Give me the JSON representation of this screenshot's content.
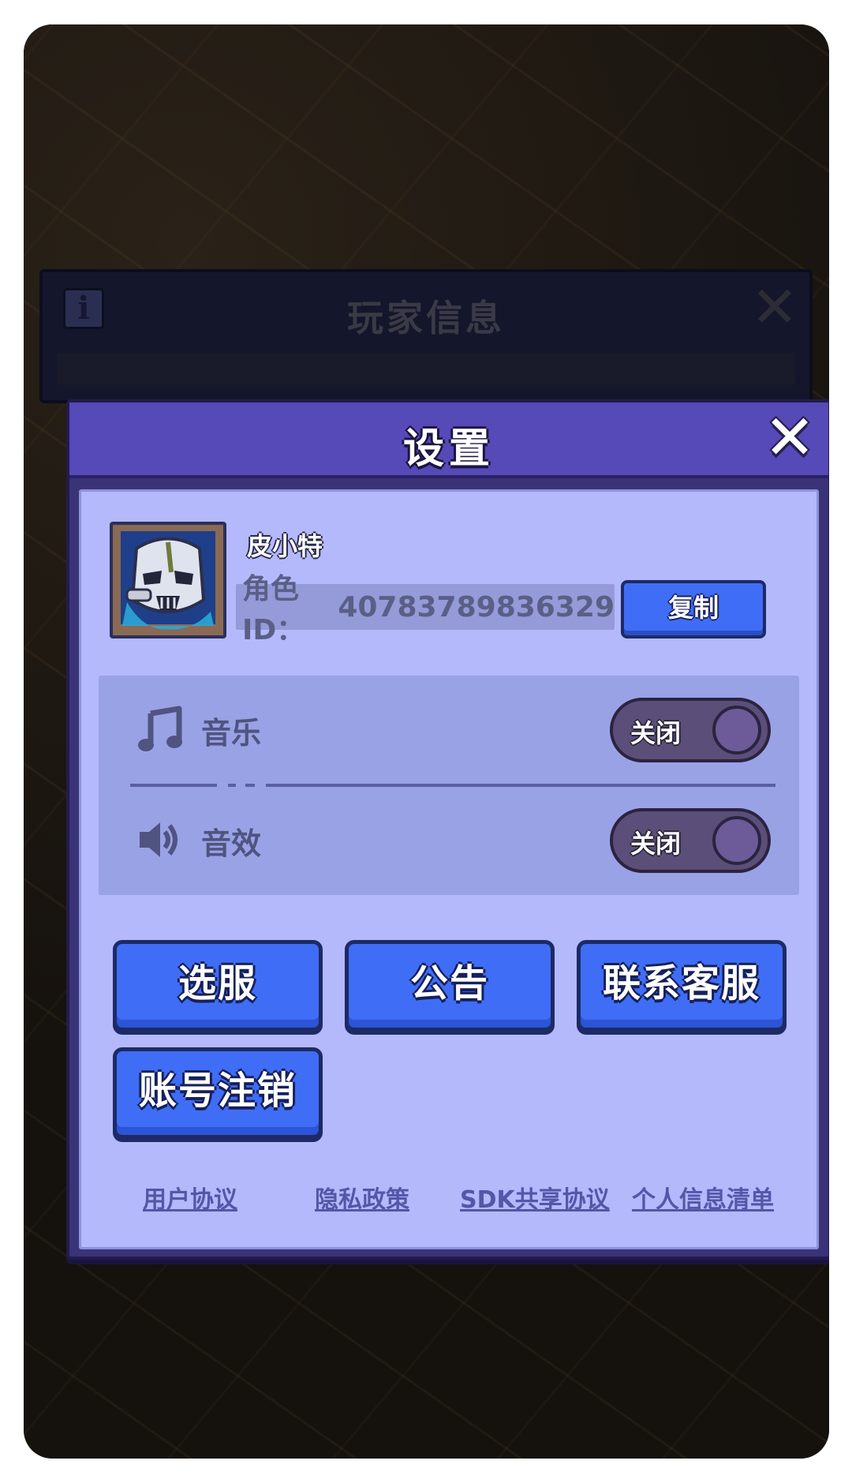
{
  "background_panel": {
    "title": "玩家信息",
    "info_icon_glyph": "i",
    "close_glyph": "✕"
  },
  "dialog": {
    "title": "设置",
    "close_glyph": "✕"
  },
  "profile": {
    "name": "皮小特",
    "role_id_label": "角色ID：",
    "role_id_value": "40783789836329",
    "copy_button": "复制"
  },
  "sound": {
    "music": {
      "label": "音乐",
      "icon": "music-note-icon",
      "toggle_label": "关闭",
      "enabled": false
    },
    "sfx": {
      "label": "音效",
      "icon": "speaker-icon",
      "toggle_label": "关闭",
      "enabled": false
    }
  },
  "buttons": {
    "select_server": "选服",
    "announcement": "公告",
    "contact_support": "联系客服",
    "delete_account": "账号注销"
  },
  "links": {
    "user_agreement": "用户协议",
    "privacy_policy": "隐私政策",
    "sdk_sharing": "SDK共享协议",
    "personal_info_list": "个人信息清单"
  },
  "colors": {
    "header": "#5649b8",
    "body": "#b3b9fb",
    "button": "#3f6df5",
    "toggle_off": "#5b4e78"
  }
}
